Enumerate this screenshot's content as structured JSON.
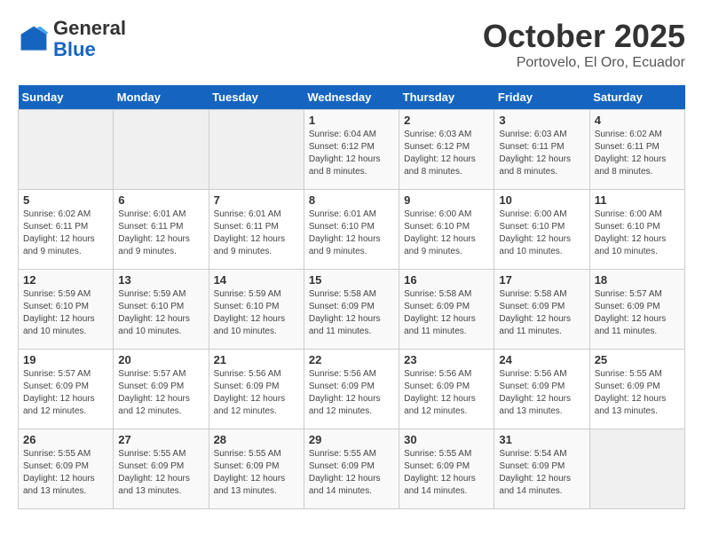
{
  "header": {
    "logo_line1": "General",
    "logo_line2": "Blue",
    "month": "October 2025",
    "location": "Portovelo, El Oro, Ecuador"
  },
  "days_of_week": [
    "Sunday",
    "Monday",
    "Tuesday",
    "Wednesday",
    "Thursday",
    "Friday",
    "Saturday"
  ],
  "weeks": [
    [
      {
        "day": "",
        "info": ""
      },
      {
        "day": "",
        "info": ""
      },
      {
        "day": "",
        "info": ""
      },
      {
        "day": "1",
        "info": "Sunrise: 6:04 AM\nSunset: 6:12 PM\nDaylight: 12 hours and 8 minutes."
      },
      {
        "day": "2",
        "info": "Sunrise: 6:03 AM\nSunset: 6:12 PM\nDaylight: 12 hours and 8 minutes."
      },
      {
        "day": "3",
        "info": "Sunrise: 6:03 AM\nSunset: 6:11 PM\nDaylight: 12 hours and 8 minutes."
      },
      {
        "day": "4",
        "info": "Sunrise: 6:02 AM\nSunset: 6:11 PM\nDaylight: 12 hours and 8 minutes."
      }
    ],
    [
      {
        "day": "5",
        "info": "Sunrise: 6:02 AM\nSunset: 6:11 PM\nDaylight: 12 hours and 9 minutes."
      },
      {
        "day": "6",
        "info": "Sunrise: 6:01 AM\nSunset: 6:11 PM\nDaylight: 12 hours and 9 minutes."
      },
      {
        "day": "7",
        "info": "Sunrise: 6:01 AM\nSunset: 6:11 PM\nDaylight: 12 hours and 9 minutes."
      },
      {
        "day": "8",
        "info": "Sunrise: 6:01 AM\nSunset: 6:10 PM\nDaylight: 12 hours and 9 minutes."
      },
      {
        "day": "9",
        "info": "Sunrise: 6:00 AM\nSunset: 6:10 PM\nDaylight: 12 hours and 9 minutes."
      },
      {
        "day": "10",
        "info": "Sunrise: 6:00 AM\nSunset: 6:10 PM\nDaylight: 12 hours and 10 minutes."
      },
      {
        "day": "11",
        "info": "Sunrise: 6:00 AM\nSunset: 6:10 PM\nDaylight: 12 hours and 10 minutes."
      }
    ],
    [
      {
        "day": "12",
        "info": "Sunrise: 5:59 AM\nSunset: 6:10 PM\nDaylight: 12 hours and 10 minutes."
      },
      {
        "day": "13",
        "info": "Sunrise: 5:59 AM\nSunset: 6:10 PM\nDaylight: 12 hours and 10 minutes."
      },
      {
        "day": "14",
        "info": "Sunrise: 5:59 AM\nSunset: 6:10 PM\nDaylight: 12 hours and 10 minutes."
      },
      {
        "day": "15",
        "info": "Sunrise: 5:58 AM\nSunset: 6:09 PM\nDaylight: 12 hours and 11 minutes."
      },
      {
        "day": "16",
        "info": "Sunrise: 5:58 AM\nSunset: 6:09 PM\nDaylight: 12 hours and 11 minutes."
      },
      {
        "day": "17",
        "info": "Sunrise: 5:58 AM\nSunset: 6:09 PM\nDaylight: 12 hours and 11 minutes."
      },
      {
        "day": "18",
        "info": "Sunrise: 5:57 AM\nSunset: 6:09 PM\nDaylight: 12 hours and 11 minutes."
      }
    ],
    [
      {
        "day": "19",
        "info": "Sunrise: 5:57 AM\nSunset: 6:09 PM\nDaylight: 12 hours and 12 minutes."
      },
      {
        "day": "20",
        "info": "Sunrise: 5:57 AM\nSunset: 6:09 PM\nDaylight: 12 hours and 12 minutes."
      },
      {
        "day": "21",
        "info": "Sunrise: 5:56 AM\nSunset: 6:09 PM\nDaylight: 12 hours and 12 minutes."
      },
      {
        "day": "22",
        "info": "Sunrise: 5:56 AM\nSunset: 6:09 PM\nDaylight: 12 hours and 12 minutes."
      },
      {
        "day": "23",
        "info": "Sunrise: 5:56 AM\nSunset: 6:09 PM\nDaylight: 12 hours and 12 minutes."
      },
      {
        "day": "24",
        "info": "Sunrise: 5:56 AM\nSunset: 6:09 PM\nDaylight: 12 hours and 13 minutes."
      },
      {
        "day": "25",
        "info": "Sunrise: 5:55 AM\nSunset: 6:09 PM\nDaylight: 12 hours and 13 minutes."
      }
    ],
    [
      {
        "day": "26",
        "info": "Sunrise: 5:55 AM\nSunset: 6:09 PM\nDaylight: 12 hours and 13 minutes."
      },
      {
        "day": "27",
        "info": "Sunrise: 5:55 AM\nSunset: 6:09 PM\nDaylight: 12 hours and 13 minutes."
      },
      {
        "day": "28",
        "info": "Sunrise: 5:55 AM\nSunset: 6:09 PM\nDaylight: 12 hours and 13 minutes."
      },
      {
        "day": "29",
        "info": "Sunrise: 5:55 AM\nSunset: 6:09 PM\nDaylight: 12 hours and 14 minutes."
      },
      {
        "day": "30",
        "info": "Sunrise: 5:55 AM\nSunset: 6:09 PM\nDaylight: 12 hours and 14 minutes."
      },
      {
        "day": "31",
        "info": "Sunrise: 5:54 AM\nSunset: 6:09 PM\nDaylight: 12 hours and 14 minutes."
      },
      {
        "day": "",
        "info": ""
      }
    ]
  ]
}
